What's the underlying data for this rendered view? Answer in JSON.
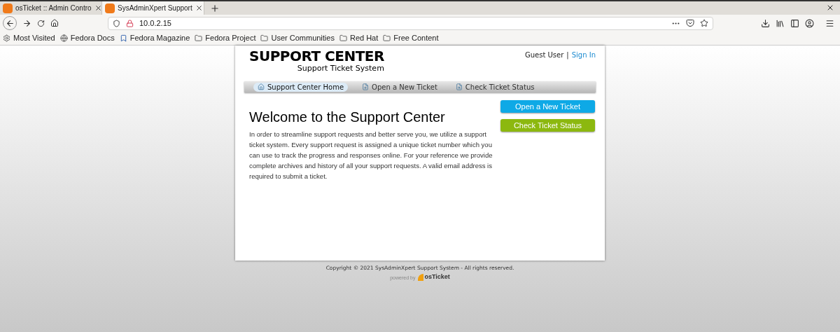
{
  "browser": {
    "tabs": [
      {
        "title": "osTicket :: Admin Contro",
        "selected": false
      },
      {
        "title": "SysAdminXpert Support",
        "selected": true
      }
    ],
    "address": "10.0.2.15",
    "bookmarks": [
      {
        "label": "Most Visited",
        "kind": "gear"
      },
      {
        "label": "Fedora Docs",
        "kind": "globe"
      },
      {
        "label": "Fedora Magazine",
        "kind": "bookmark"
      },
      {
        "label": "Fedora Project",
        "kind": "folder"
      },
      {
        "label": "User Communities",
        "kind": "folder"
      },
      {
        "label": "Red Hat",
        "kind": "folder"
      },
      {
        "label": "Free Content",
        "kind": "folder"
      }
    ]
  },
  "header": {
    "logo_title": "SUPPORT CENTER",
    "logo_subtitle": "Support Ticket System",
    "user": "Guest User",
    "separator": "|",
    "sign_in": "Sign In"
  },
  "nav": [
    {
      "label": "Support Center Home",
      "kind": "home",
      "selected": true
    },
    {
      "label": "Open a New Ticket",
      "kind": "new",
      "selected": false
    },
    {
      "label": "Check Ticket Status",
      "kind": "status",
      "selected": false
    }
  ],
  "welcome": {
    "heading": "Welcome to the Support Center",
    "body": "In order to streamline support requests and better serve you, we utilize a support ticket system. Every support request is assigned a unique ticket number which you can use to track the progress and responses online. For your reference we provide complete archives and history of all your support requests. A valid email address is required to submit a ticket."
  },
  "actions": [
    {
      "label": "Open a New Ticket",
      "color": "#0ea9e6"
    },
    {
      "label": "Check Ticket Status",
      "color": "#8cb80f"
    }
  ],
  "footer": {
    "copyright": "Copyright © 2021 SysAdminXpert Support System - All rights reserved.",
    "powered_by": "powered by",
    "brand": "osTicket"
  }
}
